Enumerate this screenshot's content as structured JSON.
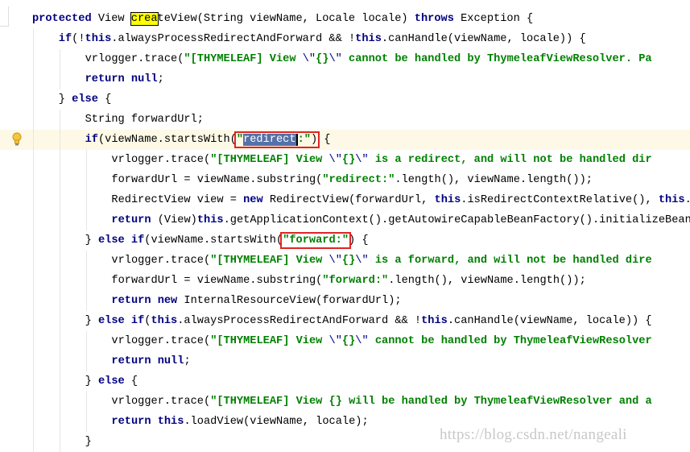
{
  "editor": {
    "language": "java",
    "colors": {
      "keyword": "#000080",
      "string": "#008000",
      "current_line": "#fdf9e6",
      "selection": "#5471a8",
      "find_highlight": "#ffff00",
      "annotation_box": "#e02424"
    },
    "gutter_icons": [
      {
        "line": 7,
        "icon": "lightbulb-icon"
      }
    ],
    "lines": [
      {
        "indent": 0,
        "tokens": [
          [
            "k",
            "protected"
          ],
          [
            "p",
            " View "
          ],
          [
            "find",
            "crea"
          ],
          [
            "p",
            "teView(String viewName, Locale locale) "
          ],
          [
            "k",
            "throws"
          ],
          [
            "p",
            " Exception {"
          ]
        ]
      },
      {
        "indent": 4,
        "tokens": [
          [
            "k",
            "if"
          ],
          [
            "p",
            "(!"
          ],
          [
            "k",
            "this"
          ],
          [
            "p",
            ".alwaysProcessRedirectAndForward && !"
          ],
          [
            "k",
            "this"
          ],
          [
            "p",
            ".canHandle(viewName, locale)) {"
          ]
        ]
      },
      {
        "indent": 8,
        "tokens": [
          [
            "p",
            "vrlogger.trace("
          ],
          [
            "s",
            "\"[THYMELEAF] View "
          ],
          [
            "e",
            "\\\""
          ],
          [
            "s",
            "{}"
          ],
          [
            "e",
            "\\\""
          ],
          [
            "s",
            " cannot be handled by ThymeleafViewResolver. Pa"
          ]
        ]
      },
      {
        "indent": 8,
        "tokens": [
          [
            "k",
            "return null"
          ],
          [
            "p",
            ";"
          ]
        ]
      },
      {
        "indent": 4,
        "tokens": [
          [
            "p",
            "} "
          ],
          [
            "k",
            "else"
          ],
          [
            "p",
            " {"
          ]
        ]
      },
      {
        "indent": 8,
        "tokens": [
          [
            "p",
            "String forwardUrl;"
          ]
        ]
      },
      {
        "indent": 8,
        "current": true,
        "tokens": [
          [
            "k",
            "if"
          ],
          [
            "p",
            "(viewName.startsWith("
          ],
          [
            "s",
            "\"",
            "box"
          ],
          [
            "sel",
            "redirect",
            "box"
          ],
          [
            "s",
            ":\"",
            "box"
          ],
          [
            "p",
            ")",
            "box"
          ],
          [
            "p",
            " {"
          ]
        ]
      },
      {
        "indent": 12,
        "tokens": [
          [
            "p",
            "vrlogger.trace("
          ],
          [
            "s",
            "\"[THYMELEAF] View "
          ],
          [
            "e",
            "\\\""
          ],
          [
            "s",
            "{}"
          ],
          [
            "e",
            "\\\""
          ],
          [
            "s",
            " is a redirect, and will not be handled dir"
          ]
        ]
      },
      {
        "indent": 12,
        "tokens": [
          [
            "p",
            "forwardUrl = viewName.substring("
          ],
          [
            "s",
            "\"redirect:\""
          ],
          [
            "p",
            ".length(), viewName.length());"
          ]
        ]
      },
      {
        "indent": 12,
        "tokens": [
          [
            "p",
            "RedirectView view = "
          ],
          [
            "k",
            "new"
          ],
          [
            "p",
            " RedirectView(forwardUrl, "
          ],
          [
            "k",
            "this"
          ],
          [
            "p",
            ".isRedirectContextRelative(), "
          ],
          [
            "k",
            "this"
          ],
          [
            "p",
            ".i"
          ]
        ]
      },
      {
        "indent": 12,
        "tokens": [
          [
            "k",
            "return"
          ],
          [
            "p",
            " (View)"
          ],
          [
            "k",
            "this"
          ],
          [
            "p",
            ".getApplicationContext().getAutowireCapableBeanFactory().initializeBean("
          ]
        ]
      },
      {
        "indent": 8,
        "tokens": [
          [
            "p",
            "} "
          ],
          [
            "k",
            "else if"
          ],
          [
            "p",
            "(viewName.startsWith("
          ],
          [
            "s",
            "\"forward:\"",
            "box"
          ],
          [
            "p",
            ")"
          ],
          [
            "p",
            " {"
          ]
        ]
      },
      {
        "indent": 12,
        "tokens": [
          [
            "p",
            "vrlogger.trace("
          ],
          [
            "s",
            "\"[THYMELEAF] View "
          ],
          [
            "e",
            "\\\""
          ],
          [
            "s",
            "{}"
          ],
          [
            "e",
            "\\\""
          ],
          [
            "s",
            " is a forward, and will not be handled dire"
          ]
        ]
      },
      {
        "indent": 12,
        "tokens": [
          [
            "p",
            "forwardUrl = viewName.substring("
          ],
          [
            "s",
            "\"forward:\""
          ],
          [
            "p",
            ".length(), viewName.length());"
          ]
        ]
      },
      {
        "indent": 12,
        "tokens": [
          [
            "k",
            "return new"
          ],
          [
            "p",
            " InternalResourceView(forwardUrl);"
          ]
        ]
      },
      {
        "indent": 8,
        "tokens": [
          [
            "p",
            "} "
          ],
          [
            "k",
            "else if"
          ],
          [
            "p",
            "("
          ],
          [
            "k",
            "this"
          ],
          [
            "p",
            ".alwaysProcessRedirectAndForward && !"
          ],
          [
            "k",
            "this"
          ],
          [
            "p",
            ".canHandle(viewName, locale)) {"
          ]
        ]
      },
      {
        "indent": 12,
        "tokens": [
          [
            "p",
            "vrlogger.trace("
          ],
          [
            "s",
            "\"[THYMELEAF] View "
          ],
          [
            "e",
            "\\\""
          ],
          [
            "s",
            "{}"
          ],
          [
            "e",
            "\\\""
          ],
          [
            "s",
            " cannot be handled by ThymeleafViewResolver"
          ]
        ]
      },
      {
        "indent": 12,
        "tokens": [
          [
            "k",
            "return null"
          ],
          [
            "p",
            ";"
          ]
        ]
      },
      {
        "indent": 8,
        "tokens": [
          [
            "p",
            "} "
          ],
          [
            "k",
            "else"
          ],
          [
            "p",
            " {"
          ]
        ]
      },
      {
        "indent": 12,
        "tokens": [
          [
            "p",
            "vrlogger.trace("
          ],
          [
            "s",
            "\"[THYMELEAF] View {} will be handled by ThymeleafViewResolver and a"
          ]
        ]
      },
      {
        "indent": 12,
        "tokens": [
          [
            "k",
            "return this"
          ],
          [
            "p",
            ".loadView(viewName, locale);"
          ]
        ]
      },
      {
        "indent": 8,
        "tokens": [
          [
            "p",
            "}"
          ]
        ]
      }
    ]
  },
  "watermark": "https://blog.csdn.net/nangeali"
}
